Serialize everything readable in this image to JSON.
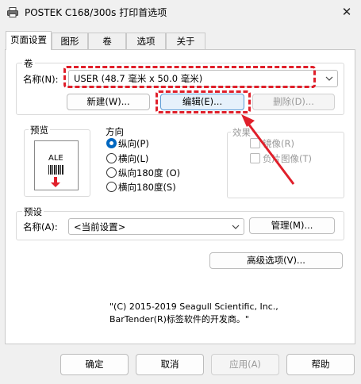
{
  "window": {
    "title": "POSTEK C168/300s 打印首选项",
    "close_icon": "close-icon"
  },
  "tabs": [
    {
      "label": "页面设置",
      "active": true
    },
    {
      "label": "图形",
      "active": false
    },
    {
      "label": "卷",
      "active": false
    },
    {
      "label": "选项",
      "active": false
    },
    {
      "label": "关于",
      "active": false
    }
  ],
  "stock": {
    "group_label": "卷",
    "name_label": "名称(N):",
    "name_value": "USER (48.7 毫米 x 50.0 毫米)",
    "new_button": "新建(W)...",
    "edit_button": "编辑(E)...",
    "delete_button": "删除(D)..."
  },
  "preview": {
    "label": "预览",
    "thumb_text": "ALE"
  },
  "orientation": {
    "label": "方向",
    "options": [
      "纵向(P)",
      "横向(L)",
      "纵向180度 (O)",
      "横向180度(S)"
    ],
    "selected": "纵向(P)"
  },
  "effects": {
    "label": "效果",
    "options": [
      "镜像(R)",
      "负片图像(T)"
    ]
  },
  "preset": {
    "label": "预设",
    "name_label": "名称(A):",
    "name_value": "<当前设置>",
    "manage_button": "管理(M)..."
  },
  "advanced_button": "高级选项(V)...",
  "copyright": {
    "line1": "\"(C) 2015-2019 Seagull Scientific, Inc.,",
    "line2": "BarTender(R)标签软件的开发商。\""
  },
  "footer": {
    "ok": "确定",
    "cancel": "取消",
    "apply": "应用(A)",
    "help": "帮助"
  },
  "colors": {
    "accent": "#0067c0",
    "annotation": "#e01f2a"
  }
}
